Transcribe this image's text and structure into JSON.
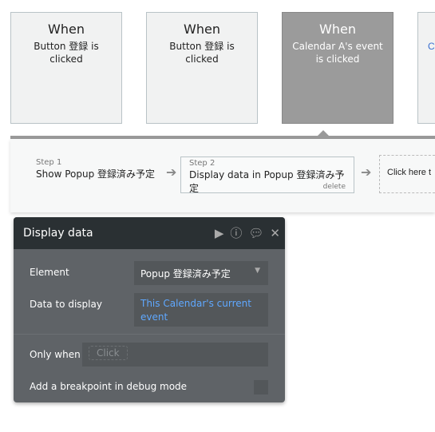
{
  "events": [
    {
      "when": "When",
      "trigger": "Button 登録 is clicked",
      "selected": false
    },
    {
      "when": "When",
      "trigger": "Button 登録 is clicked",
      "selected": false
    },
    {
      "when": "When",
      "trigger": "Calendar A's event is clicked",
      "selected": true
    },
    {
      "when": "",
      "trigger": "C",
      "selected": false
    }
  ],
  "steps": [
    {
      "num": "Step 1",
      "label": "Show Popup 登録済み予定"
    },
    {
      "num": "Step 2",
      "label": "Display data in Popup 登録済み予定",
      "delete": "delete"
    }
  ],
  "add_step": "Click here t",
  "panel": {
    "title": "Display data",
    "icons": [
      "play-icon",
      "info-icon",
      "comment-icon",
      "close-icon"
    ],
    "element_label": "Element",
    "element_value": "Popup 登録済み予定",
    "data_label": "Data to display",
    "data_value": "This Calendar's current event",
    "only_when_label": "Only when",
    "only_when_placeholder": "Click",
    "breakpoint_label": "Add a breakpoint in debug mode",
    "breakpoint_checked": false,
    "link_color": "#5fa8ff"
  }
}
